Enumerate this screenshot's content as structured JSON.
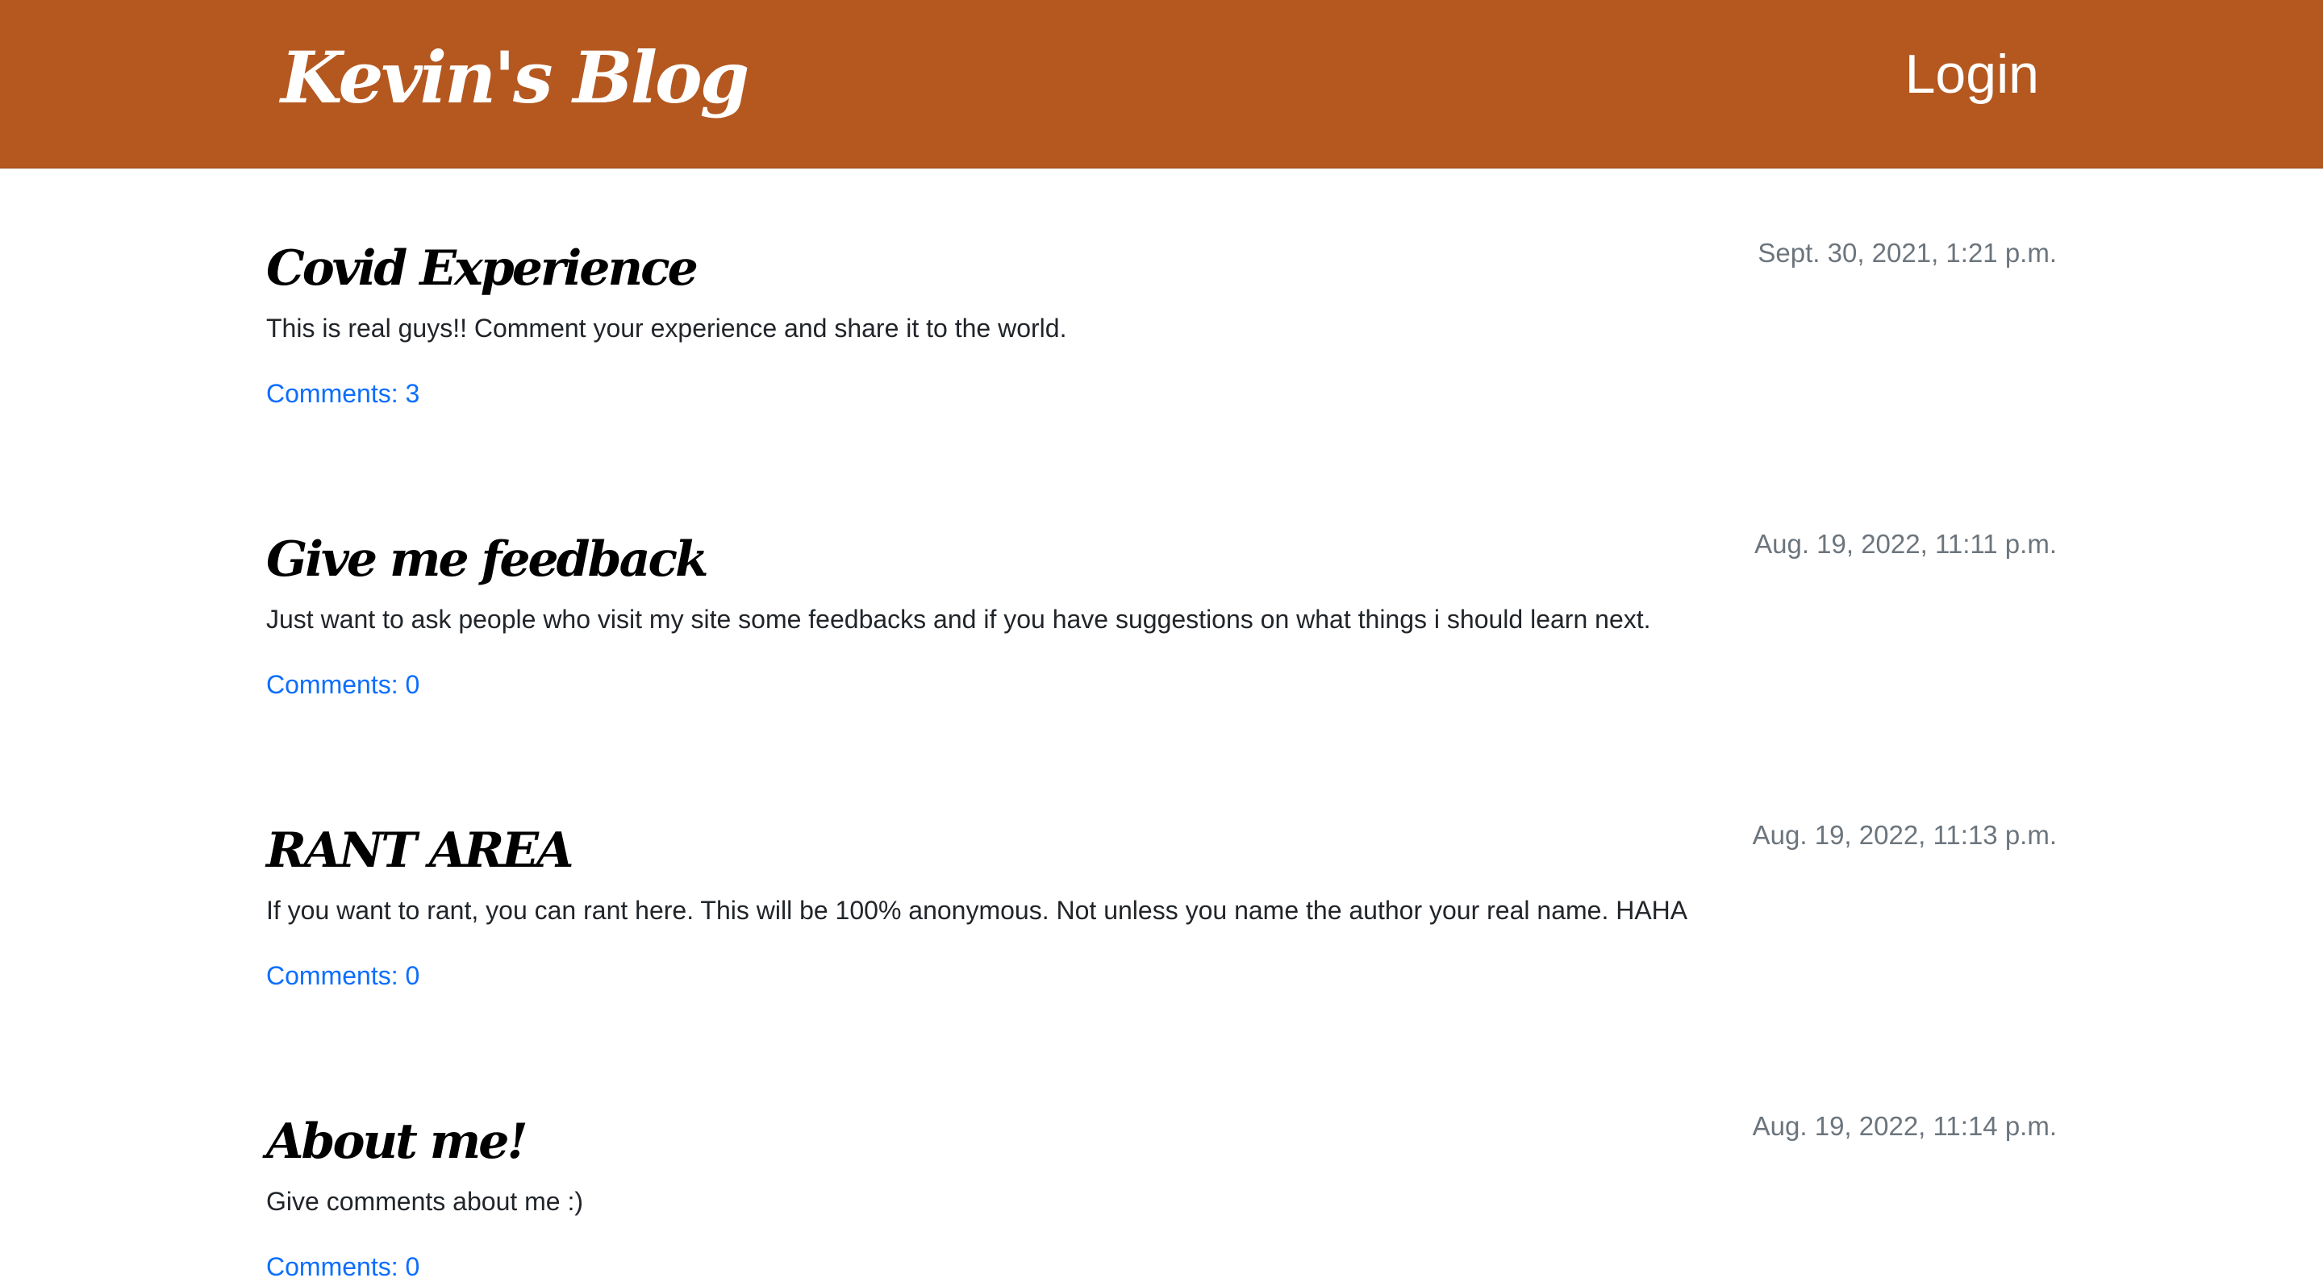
{
  "header": {
    "brand": "Kevin's Blog",
    "login_label": "Login",
    "background_color": "#b45820"
  },
  "posts": [
    {
      "title": "Covid Experience",
      "date": "Sept. 30, 2021, 1:21 p.m.",
      "body": "This is real guys!! Comment your experience and share it to the world.",
      "comments_label": "Comments:",
      "comments_count": "3"
    },
    {
      "title": "Give me feedback",
      "date": "Aug. 19, 2022, 11:11 p.m.",
      "body": "Just want to ask people who visit my site some feedbacks and if you have suggestions on what things i should learn next.",
      "comments_label": "Comments:",
      "comments_count": "0"
    },
    {
      "title": "RANT AREA",
      "date": "Aug. 19, 2022, 11:13 p.m.",
      "body": "If you want to rant, you can rant here. This will be 100% anonymous. Not unless you name the author your real name. HAHA",
      "comments_label": "Comments:",
      "comments_count": "0"
    },
    {
      "title": "About me!",
      "date": "Aug. 19, 2022, 11:14 p.m.",
      "body": "Give comments about me :)",
      "comments_label": "Comments:",
      "comments_count": "0"
    }
  ],
  "colors": {
    "link": "#0d6efd",
    "muted": "#6c757d",
    "text": "#212529"
  }
}
